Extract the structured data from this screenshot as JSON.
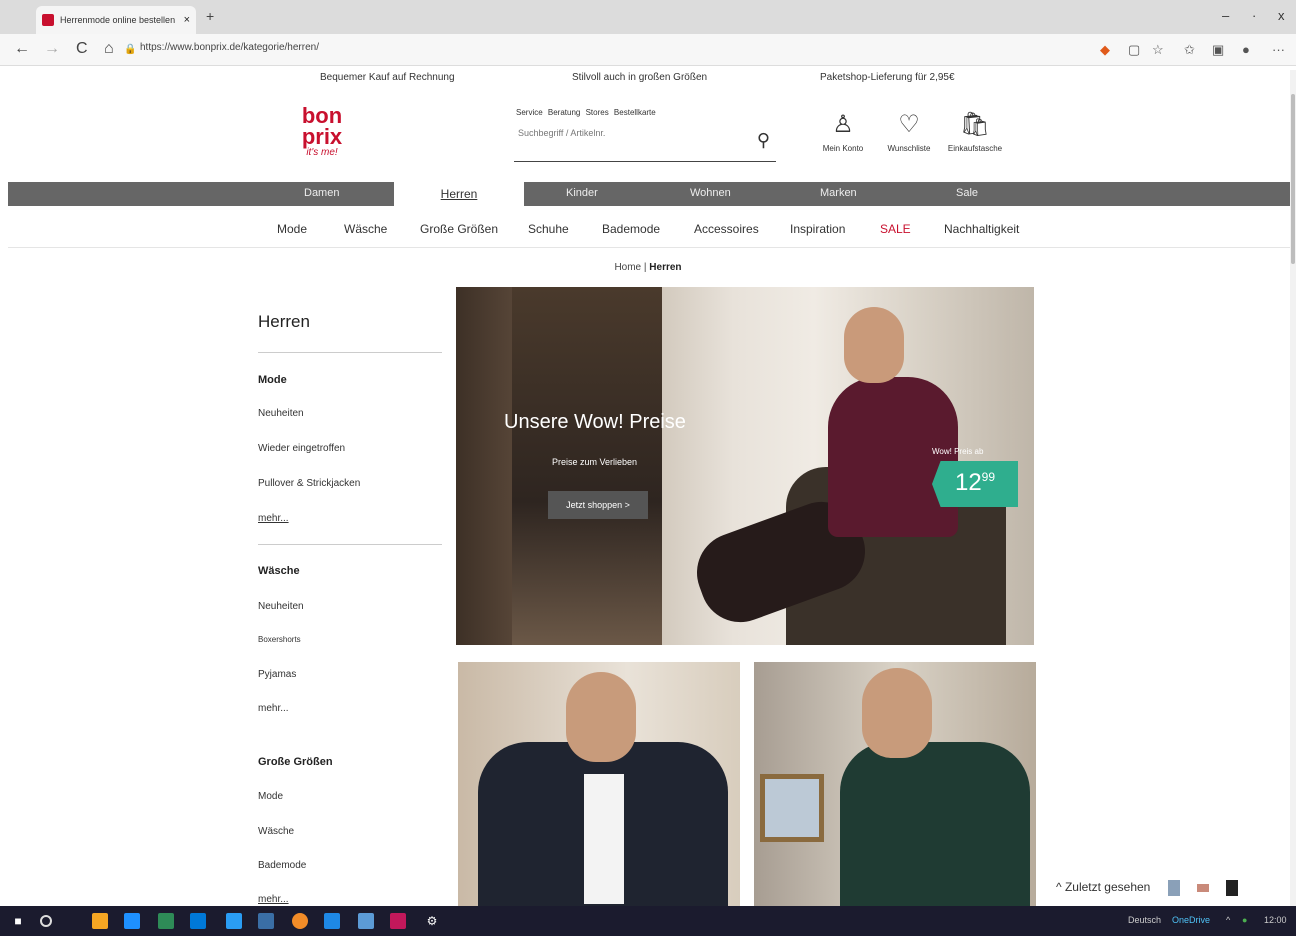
{
  "browser": {
    "tab_title": "Herrenmode online bestellen | b",
    "tab_close": "×",
    "new_tab": "+",
    "url": "https://www.bonprix.de/kategorie/herren/",
    "back": "←",
    "forward": "→",
    "reload": "C",
    "home": "⌂",
    "lock": "🔒",
    "min": "–",
    "max": "·",
    "close": "x",
    "more": "···"
  },
  "promo": {
    "left": "Bequemer Kauf auf Rechnung",
    "center": "Stilvoll auch in großen Größen",
    "right": "Paketshop-Lieferung für 2,95€"
  },
  "logo": {
    "line1": "bon",
    "line2": "prix",
    "line3": "it's me!"
  },
  "service_links": "Service  Beratung  Stores  Bestellkarte",
  "search": {
    "placeholder": "Suchbegriff / Artikelnr.",
    "icon": "⚲"
  },
  "header_icons": [
    {
      "glyph": "♙",
      "label": "Mein Konto"
    },
    {
      "glyph": "♡",
      "label": "Wunschliste"
    },
    {
      "glyph": "🛍",
      "label": "Einkaufstasche"
    }
  ],
  "top_nav": {
    "items": [
      "Damen",
      "Herren",
      "Kinder",
      "Wohnen",
      "Marken",
      "Sale"
    ],
    "active": "Herren"
  },
  "sub_nav": [
    "Mode",
    "Wäsche",
    "Große Größen",
    "Schuhe",
    "Bademode",
    "Accessoires",
    "Inspiration",
    "SALE",
    "Nachhaltigkeit"
  ],
  "sub_nav_sale_color": "#c8102e",
  "breadcrumb": {
    "home": "Home",
    "sep": "|",
    "current": "Herren"
  },
  "sidebar": {
    "title": "Herren",
    "sections": [
      {
        "title": "Mode",
        "items": [
          "Neuheiten",
          "Wieder eingetroffen",
          "Pullover & Strickjacken",
          "mehr..."
        ]
      },
      {
        "title": "Wäsche",
        "items": [
          "Neuheiten",
          "Boxershorts",
          "Pyjamas",
          "mehr..."
        ]
      },
      {
        "title": "Große Größen",
        "items": [
          "Mode",
          "Wäsche",
          "Bademode",
          "mehr..."
        ]
      }
    ]
  },
  "hero": {
    "headline": "Unsere Wow! Preise",
    "subline": "Preise zum Verlieben",
    "cta": "Jetzt shoppen >",
    "price_label": "Wow! Preis ab",
    "price_main": "12",
    "price_cents": "99",
    "price_color": "#2fae8e"
  },
  "recently_viewed": "^ Zuletzt gesehen",
  "taskbar": {
    "start": "■",
    "tray_lang": "Deutsch",
    "tray_cloud": "OneDrive",
    "tray_time": "12:00"
  },
  "colors": {
    "brand": "#c8102e",
    "nav_bar": "#666666"
  }
}
